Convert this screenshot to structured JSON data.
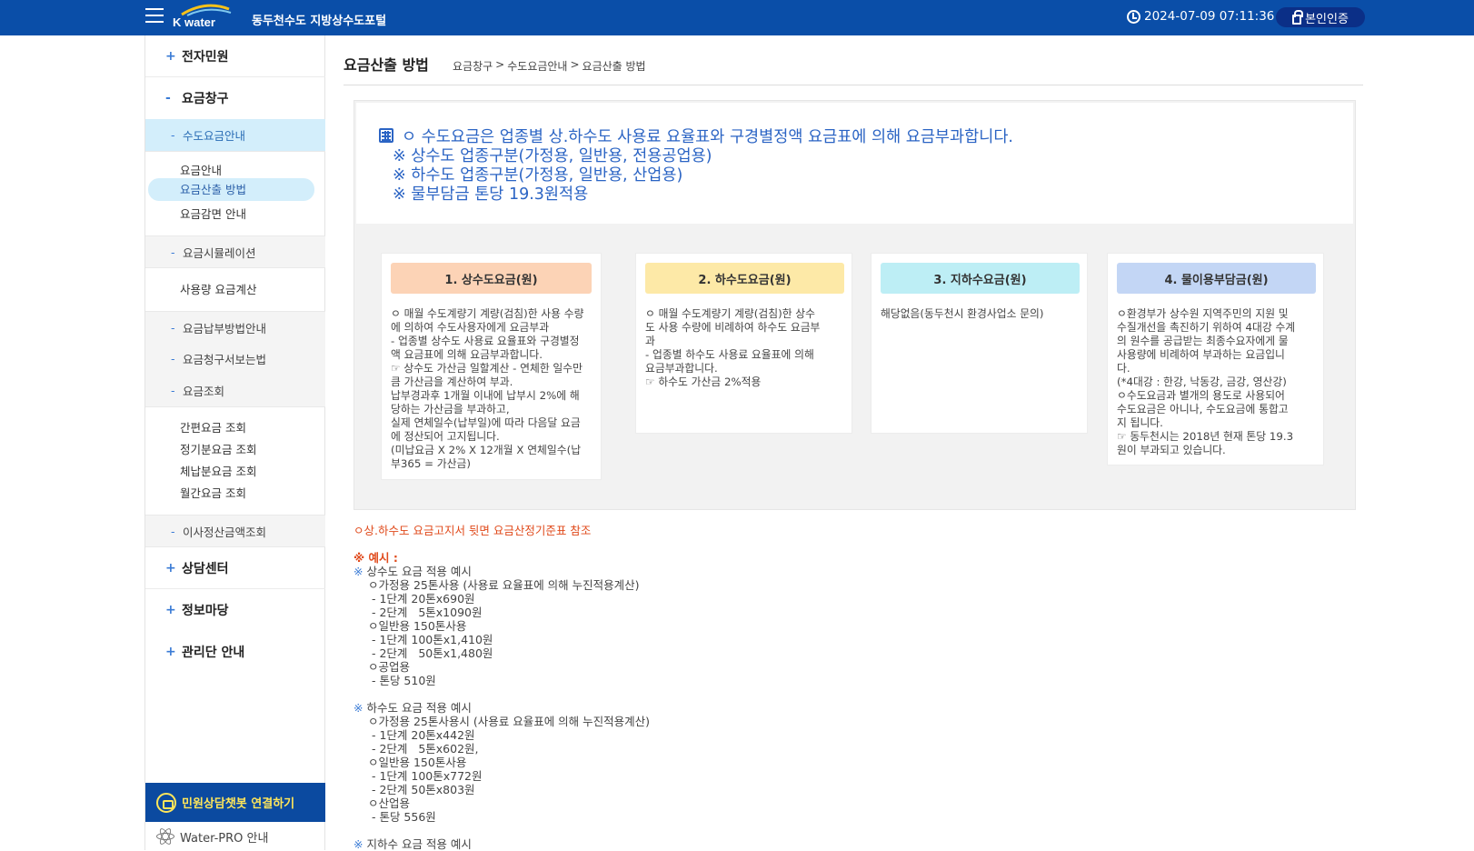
{
  "header": {
    "logo_text": "K water",
    "portal_title": "동두천수도 지방상수도포털",
    "datetime": "2024-07-09 07:11:36",
    "auth_label": "본인인증"
  },
  "sidebar": {
    "menus": [
      {
        "label": "전자민원",
        "toggle": "+"
      },
      {
        "label": "요금창구",
        "toggle": "-"
      },
      {
        "label": "상담센터",
        "toggle": "+"
      },
      {
        "label": "정보마당",
        "toggle": "+"
      },
      {
        "label": "관리단 안내",
        "toggle": "+"
      }
    ],
    "subs": [
      {
        "label": "수도요금안내"
      },
      {
        "label": "요금시뮬레이션"
      },
      {
        "label": "요금납부방법안내"
      },
      {
        "label": "요금청구서보는법"
      },
      {
        "label": "요금조회"
      },
      {
        "label": "이사정산금액조회"
      }
    ],
    "leaves": [
      {
        "label": "요금안내"
      },
      {
        "label": "요금산출 방법"
      },
      {
        "label": "요금감면 안내"
      },
      {
        "label": "사용량 요금계산"
      },
      {
        "label": "간편요금 조회"
      },
      {
        "label": "정기분요금 조회"
      },
      {
        "label": "체납분요금 조회"
      },
      {
        "label": "월간요금 조회"
      }
    ],
    "sub_dash": "-",
    "chatbot_label": "민원상담챗봇 연결하기",
    "waterpro_label": "Water-PRO 안내"
  },
  "main": {
    "title": "요금산출 방법",
    "breadcrumb": [
      "요금창구",
      ">",
      "수도요금안내",
      ">",
      "요금산출 방법"
    ],
    "notice": [
      "ㅇ 수도요금은 업종별 상.하수도 사용료 요율표와 구경별정액 요금표에 의해 요금부과합니다.",
      "※ 상수도 업종구분(가정용, 일반용, 전용공업용)",
      "※ 하수도 업종구분(가정용, 일반용, 산업용)",
      "※ 물부담금 톤당 19.3원적용"
    ],
    "cards": [
      {
        "title": "1. 상수도요금(원)",
        "color": "#fcd3b6",
        "body": "ㅇ 매월 수도계량기 계량(검침)한 사용 수량\n에 의하여 수도사용자에게 요금부과\n- 업종별 상수도 사용료 요율표와 구경별정\n액 요금표에 의해 요금부과합니다.\n☞ 상수도 가산금 일할계산 - 연체한 일수만\n큼 가산금을 계산하여 부과.\n납부경과후 1개월 이내에 납부시 2%에 해\n당하는 가산금을 부과하고,\n실제 연체일수(납부일)에 따라 다음달 요금\n에 정산되어 고지됩니다.\n(미납요금 X 2% X 12개월 X 연체일수(납\n부365 = 가산금)"
      },
      {
        "title": "2. 하수도요금(원)",
        "color": "#fde9a7",
        "body": "ㅇ 매월 수도계량기 계량(검침)한 상수\n도 사용 수량에 비례하여 하수도 요금부\n과\n- 업종별 하수도 사용료 요율표에 의해\n요금부과합니다.\n☞ 하수도 가산금 2%적용"
      },
      {
        "title": "3. 지하수요금(원)",
        "color": "#bdeef5",
        "body": "해당없음(동두천시 환경사업소 문의)"
      },
      {
        "title": "4. 물이용부담금(원)",
        "color": "#c3d6f5",
        "body": "ㅇ환경부가 상수원 지역주민의 지원 및\n수질개선을 촉진하기 위하여 4대강 수계\n의 원수를 공급받는 최종수요자에게 물\n사용량에 비례하여 부과하는 요금입니\n다.\n(*4대강 : 한강, 낙동강, 금강, 영산강)\nㅇ수도요금과 별개의 용도로 사용되어\n수도요금은 아니나, 수도요금에 통합고\n지 됩니다.\n☞ 동두천시는 2018년 현재 톤당 19.3\n원이 부과되고 있습니다."
      }
    ],
    "examples": {
      "ref": "ㅇ상.하수도 요금고지서 뒷면 요금산정기준표 참조",
      "head": "※ 예시 :",
      "water_head": "상수도 요금 적용 예시",
      "water_lines": [
        "ㅇ가정용 25톤사용 (사용료 요율표에 의해 누진적용계산)",
        " - 1단계 20톤x690원",
        " - 2단계   5톤x1090원",
        "ㅇ일반용 150톤사용",
        " - 1단계 100톤x1,410원",
        " - 2단계   50톤x1,480원",
        "ㅇ공업용",
        " - 톤당 510원"
      ],
      "sewer_head": "하수도 요금 적용 예시",
      "sewer_lines": [
        "ㅇ가정용 25톤사용시 (사용료 요율표에 의해 누진적용계산)",
        " - 1단계 20톤x442원",
        " - 2단계   5톤x602원,",
        "ㅇ일반용 150톤사용",
        " - 1단계 100톤x772원",
        " - 2단계 50톤x803원",
        "ㅇ산업용",
        " - 톤당 556원"
      ],
      "ground_head": "지하수 요금 적용 예시",
      "mark": "※"
    }
  }
}
